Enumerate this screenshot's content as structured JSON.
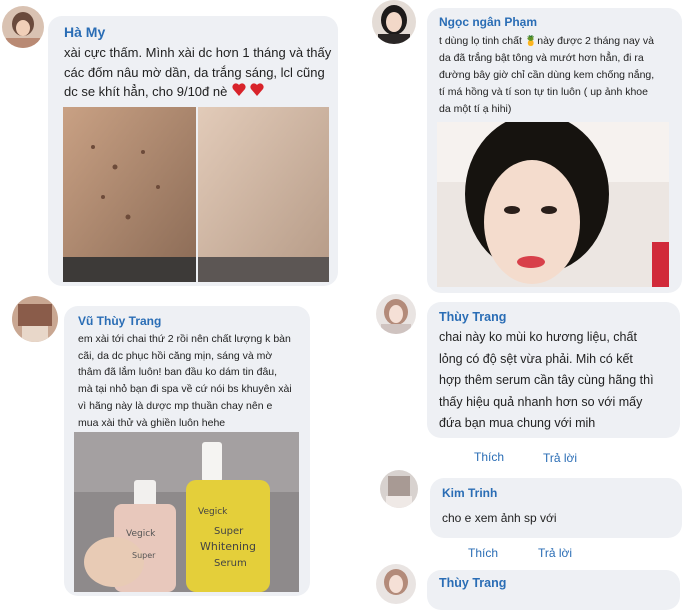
{
  "comments": [
    {
      "name": "Hà My",
      "text": "xài cực thấm. Mình xài dc hơn 1 tháng và thấy\ncác đốm nâu mờ dần, da trắng sáng, lcl cũng\ndc se khít hẳn, cho 9/10đ nè",
      "emoji": "❤️❤️"
    },
    {
      "name": "Ngọc ngân Phạm",
      "text_before": "t dùng lọ tinh chất",
      "text_after": "này được 2 tháng nay và\nda đã trắng bật tông và mướt hơn hẳn, đi ra\nđường bây giờ chỉ cần dùng kem chống nắng,\ntí má hồng và tí son tự tin luôn ( up ảnh khoe\nda một tí ạ hihi)",
      "emoji": "🍍"
    },
    {
      "name": "Vũ Thùy Trang",
      "text": "em xài tới chai thứ 2 rồi nên chất lượng k bàn\ncãi, da dc phục hồi căng mịn, sáng và mờ\nthâm đã lắm luôn! ban đầu ko dám tin đâu,\nmà tại nhỏ bạn đi spa về cứ nói bs khuyên xài\nvì hãng này là dược mp thuần chay nên e\nmua xài thử và ghiền luôn hehe",
      "bottle_labels": [
        "Vegick",
        "Super",
        "Vegick",
        "Super",
        "Whitening",
        "Serum"
      ]
    },
    {
      "name": "Thùy Trang",
      "text": "chai này ko mùi ko hương liệu, chất\nlỏng có độ sệt vừa phải. Mih có kết\nhợp thêm serum cần tây cùng hãng thì\nthấy hiệu quả nhanh hơn so với mấy\nđứa bạn mua chung với mih",
      "like_label": "Thích",
      "reply_label": "Trả lời"
    },
    {
      "name": "Kim Trinh",
      "text": "cho e xem ảnh sp với",
      "like_label": "Thích",
      "reply_label": "Trả lời"
    },
    {
      "name": "Thùy Trang"
    }
  ],
  "colors": {
    "name": "#2a6db5",
    "bubble": "#eef0f4",
    "link": "#2a6db5",
    "heart": "#d8232a"
  }
}
